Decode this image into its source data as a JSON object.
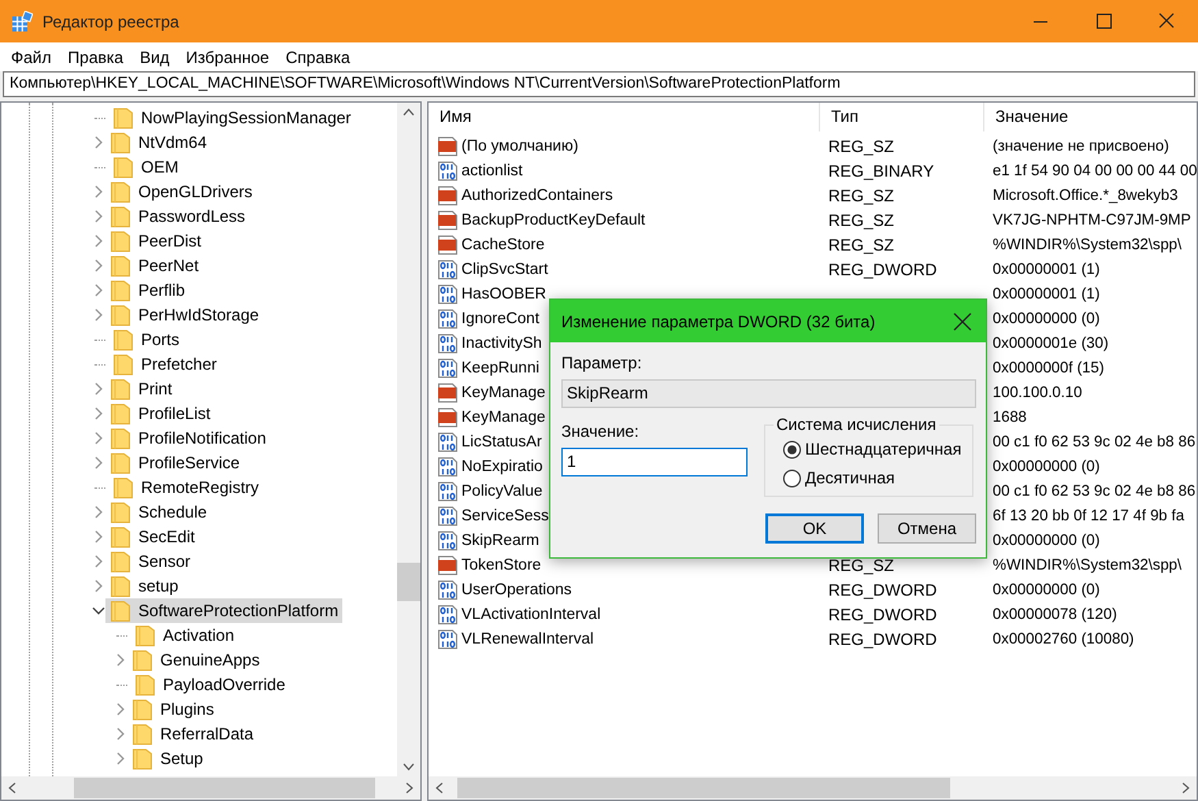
{
  "window": {
    "title": "Редактор реестра"
  },
  "menu": [
    "Файл",
    "Правка",
    "Вид",
    "Избранное",
    "Справка"
  ],
  "address": "Компьютер\\HKEY_LOCAL_MACHINE\\SOFTWARE\\Microsoft\\Windows NT\\CurrentVersion\\SoftwareProtectionPlatform",
  "tree": [
    {
      "label": "NowPlayingSessionManager",
      "has_children": false,
      "expanded": false,
      "selected": false
    },
    {
      "label": "NtVdm64",
      "has_children": true,
      "expanded": false,
      "selected": false
    },
    {
      "label": "OEM",
      "has_children": false,
      "expanded": false,
      "selected": false
    },
    {
      "label": "OpenGLDrivers",
      "has_children": true,
      "expanded": false,
      "selected": false
    },
    {
      "label": "PasswordLess",
      "has_children": true,
      "expanded": false,
      "selected": false
    },
    {
      "label": "PeerDist",
      "has_children": true,
      "expanded": false,
      "selected": false
    },
    {
      "label": "PeerNet",
      "has_children": true,
      "expanded": false,
      "selected": false
    },
    {
      "label": "Perflib",
      "has_children": true,
      "expanded": false,
      "selected": false
    },
    {
      "label": "PerHwIdStorage",
      "has_children": true,
      "expanded": false,
      "selected": false
    },
    {
      "label": "Ports",
      "has_children": false,
      "expanded": false,
      "selected": false
    },
    {
      "label": "Prefetcher",
      "has_children": false,
      "expanded": false,
      "selected": false
    },
    {
      "label": "Print",
      "has_children": true,
      "expanded": false,
      "selected": false
    },
    {
      "label": "ProfileList",
      "has_children": true,
      "expanded": false,
      "selected": false
    },
    {
      "label": "ProfileNotification",
      "has_children": true,
      "expanded": false,
      "selected": false
    },
    {
      "label": "ProfileService",
      "has_children": true,
      "expanded": false,
      "selected": false
    },
    {
      "label": "RemoteRegistry",
      "has_children": false,
      "expanded": false,
      "selected": false
    },
    {
      "label": "Schedule",
      "has_children": true,
      "expanded": false,
      "selected": false
    },
    {
      "label": "SecEdit",
      "has_children": true,
      "expanded": false,
      "selected": false
    },
    {
      "label": "Sensor",
      "has_children": true,
      "expanded": false,
      "selected": false
    },
    {
      "label": "setup",
      "has_children": true,
      "expanded": false,
      "selected": false
    },
    {
      "label": "SoftwareProtectionPlatform",
      "has_children": true,
      "expanded": true,
      "selected": true,
      "children": [
        {
          "label": "Activation",
          "has_children": false,
          "expanded": false,
          "selected": false
        },
        {
          "label": "GenuineApps",
          "has_children": true,
          "expanded": false,
          "selected": false
        },
        {
          "label": "PayloadOverride",
          "has_children": false,
          "expanded": false,
          "selected": false
        },
        {
          "label": "Plugins",
          "has_children": true,
          "expanded": false,
          "selected": false
        },
        {
          "label": "ReferralData",
          "has_children": true,
          "expanded": false,
          "selected": false
        },
        {
          "label": "Setup",
          "has_children": true,
          "expanded": false,
          "selected": false
        }
      ]
    }
  ],
  "list": {
    "columns": [
      "Имя",
      "Тип",
      "Значение"
    ],
    "rows": [
      {
        "kind": "string",
        "name": "(По умолчанию)",
        "type": "REG_SZ",
        "value": "(значение не присвоено)"
      },
      {
        "kind": "binary",
        "name": "actionlist",
        "type": "REG_BINARY",
        "value": "e1 1f 54 90 04 00 00 00 44 00"
      },
      {
        "kind": "string",
        "name": "AuthorizedContainers",
        "type": "REG_SZ",
        "value": "Microsoft.Office.*_8wekyb3"
      },
      {
        "kind": "string",
        "name": "BackupProductKeyDefault",
        "type": "REG_SZ",
        "value": "VK7JG-NPHTM-C97JM-9MP"
      },
      {
        "kind": "string",
        "name": "CacheStore",
        "type": "REG_SZ",
        "value": "%WINDIR%\\System32\\spp\\"
      },
      {
        "kind": "binary",
        "name": "ClipSvcStart",
        "type": "REG_DWORD",
        "value": "0x00000001 (1)"
      },
      {
        "kind": "binary",
        "name": "HasOOBER",
        "value": "0x00000001 (1)"
      },
      {
        "kind": "binary",
        "name": "IgnoreCont",
        "value": "0x00000000 (0)"
      },
      {
        "kind": "binary",
        "name": "InactivitySh",
        "value": "0x0000001e (30)"
      },
      {
        "kind": "binary",
        "name": "KeepRunni",
        "value": "0x0000000f (15)"
      },
      {
        "kind": "string",
        "name": "KeyManage",
        "value": "100.100.0.10"
      },
      {
        "kind": "string",
        "name": "KeyManage",
        "value": "1688"
      },
      {
        "kind": "binary",
        "name": "LicStatusAr",
        "value": "00 c1 f0 62 53 9c 02 4e b8 86"
      },
      {
        "kind": "binary",
        "name": "NoExpiratio",
        "value": "0x00000000 (0)"
      },
      {
        "kind": "binary",
        "name": "PolicyValue",
        "value": "00 c1 f0 62 53 9c 02 4e b8 86"
      },
      {
        "kind": "binary",
        "name": "ServiceSess",
        "value": "6f 13 20 bb 0f 12 17 4f 9b fa"
      },
      {
        "kind": "binary",
        "name": "SkipRearm",
        "value": "0x00000000 (0)"
      },
      {
        "kind": "string",
        "name": "TokenStore",
        "type": "REG_SZ",
        "value": "%WINDIR%\\System32\\spp\\"
      },
      {
        "kind": "binary",
        "name": "UserOperations",
        "type": "REG_DWORD",
        "value": "0x00000000 (0)"
      },
      {
        "kind": "binary",
        "name": "VLActivationInterval",
        "type": "REG_DWORD",
        "value": "0x00000078 (120)"
      },
      {
        "kind": "binary",
        "name": "VLRenewalInterval",
        "type": "REG_DWORD",
        "value": "0x00002760 (10080)"
      }
    ]
  },
  "dialog": {
    "title": "Изменение параметра DWORD (32 бита)",
    "name_label": "Параметр:",
    "name_value": "SkipRearm",
    "value_label": "Значение:",
    "value": "1",
    "base_group": "Система исчисления",
    "bases": [
      {
        "label": "Шестнадцатеричная",
        "selected": true
      },
      {
        "label": "Десятичная",
        "selected": false
      }
    ],
    "buttons": [
      {
        "label": "OK",
        "default": true
      },
      {
        "label": "Отмена",
        "default": false
      }
    ]
  }
}
